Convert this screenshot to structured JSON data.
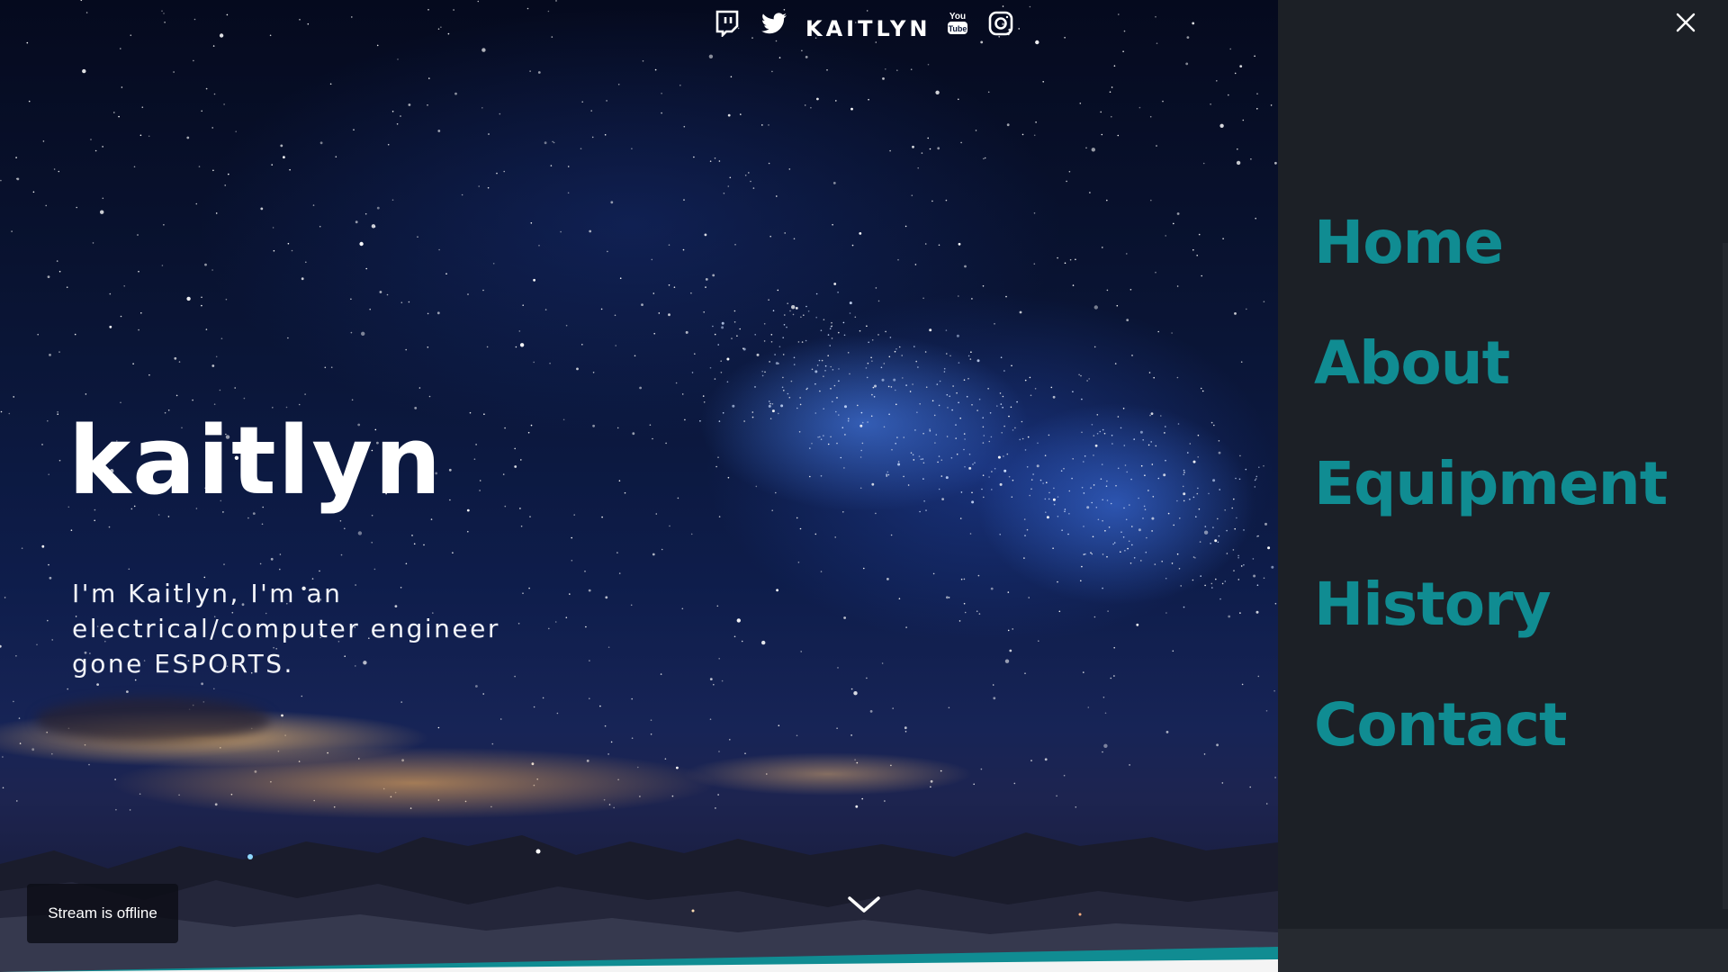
{
  "header": {
    "brand": "KAITLYN",
    "social_icons": [
      "twitch-icon",
      "twitter-icon",
      "youtube-icon",
      "instagram-icon"
    ]
  },
  "hero": {
    "title": "kaitlyn",
    "subtitle": "I'm Kaitlyn, I'm an electrical/computer engineer gone ESPORTS."
  },
  "stream": {
    "status": "Stream is offline"
  },
  "nav": {
    "items": [
      {
        "label": "Home"
      },
      {
        "label": "About"
      },
      {
        "label": "Equipment"
      },
      {
        "label": "History"
      },
      {
        "label": "Contact"
      }
    ]
  },
  "colors": {
    "accent": "#108c92",
    "panel": "#1c2026",
    "sky_dark": "#050a1e"
  }
}
